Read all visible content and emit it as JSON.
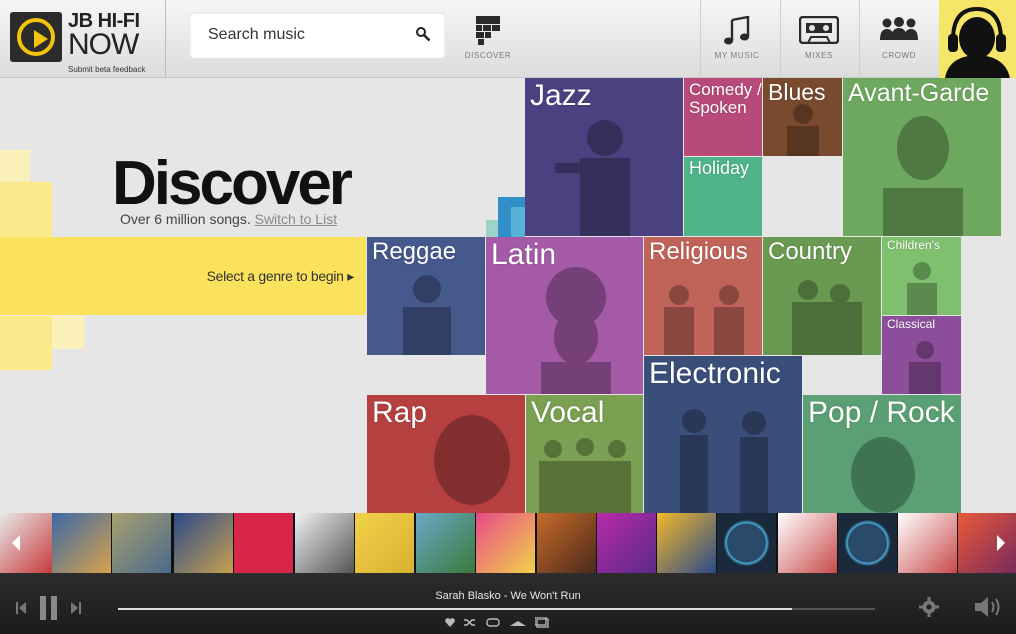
{
  "header": {
    "brand_top": "JB HI-FI",
    "brand_bottom": "NOW",
    "feedback": "Submit beta feedback",
    "search_placeholder": "Search music",
    "nav": {
      "discover": "DISCOVER",
      "my_music": "MY MUSIC",
      "mixes": "MIXES",
      "crowd": "CROWD"
    }
  },
  "hero": {
    "title": "Discover",
    "subtitle": "Over 6 million songs.",
    "switch_link": "Switch to List",
    "select_prompt": "Select a genre to begin ▸"
  },
  "genres": {
    "jazz": "Jazz",
    "comedy": "Comedy / Spoken",
    "blues": "Blues",
    "avant_garde": "Avant-Garde",
    "holiday": "Holiday",
    "reggae": "Reggae",
    "latin": "Latin",
    "religious": "Religious",
    "country": "Country",
    "childrens": "Children's",
    "classical": "Classical",
    "electronic": "Electronic",
    "rap": "Rap",
    "vocal": "Vocal",
    "pop_rock": "Pop / Rock"
  },
  "colors": {
    "jazz": "#4a4280",
    "comedy": "#b84a7a",
    "blues": "#7a4a2e",
    "avant_garde": "#6ea85e",
    "holiday": "#4fb48a",
    "reggae": "#46598c",
    "latin": "#a45aa6",
    "religious": "#c0645a",
    "country": "#6a9a52",
    "childrens": "#7fc06e",
    "classical": "#8c4e9a",
    "electronic": "#3a4e7a",
    "rap": "#b64040",
    "vocal": "#7aa052",
    "pop_rock": "#5aa074",
    "accent": "#fbe25c"
  },
  "player": {
    "now_playing": "Sarah Blasko - We Won't Run",
    "progress": 0.89
  }
}
